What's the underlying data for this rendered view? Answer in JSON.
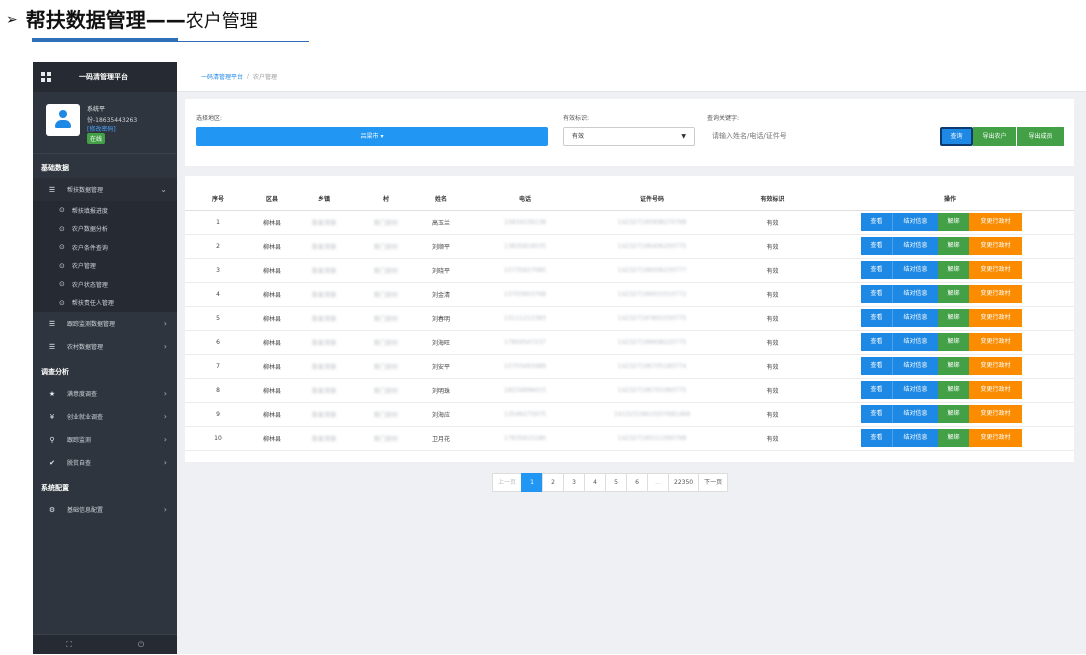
{
  "doc": {
    "arrow": "➢",
    "title_bold": "帮扶数据管理——",
    "title_thin": "农户管理"
  },
  "sidebar": {
    "brand": "一码清管理平台",
    "user": {
      "name": "系统平",
      "phone": "份-18635443263",
      "edit": "[修改密码]",
      "status": "在线"
    },
    "sections": {
      "basic": "基础数据",
      "survey": "调查分析",
      "system": "系统配置"
    },
    "items": {
      "help_data": "帮扶数据管理",
      "track": "跟踪监测数据管理",
      "village": "农村数据管理",
      "satisfaction": "满意度调查",
      "employment": "创业就业调查",
      "follow": "跟踪监测",
      "poverty": "脱贫自查",
      "base_config": "基础信息配置"
    },
    "subs": {
      "fill_progress": "帮扶填报进度",
      "farmer_analysis": "农户数据分析",
      "farmer_query": "农户条件查询",
      "farmer_mgmt": "农户管理",
      "farmer_status": "农户状态管理",
      "responsible": "帮扶责任人管理"
    },
    "bottom": {
      "left": "⛶",
      "right": "⏻"
    }
  },
  "breadcrumb": {
    "root": "一码清管理平台",
    "sep": "/",
    "current": "农户管理"
  },
  "filter": {
    "region_label": "选择地区:",
    "region_value": "吕梁市 ▾",
    "valid_label": "有效标识:",
    "valid_value": "有效",
    "keyword_label": "查询关键字:",
    "keyword_placeholder": "请输入姓名/电话/证件号",
    "query_btn": "查询",
    "export_farmer_btn": "导出农户",
    "export_member_btn": "导出成员"
  },
  "table": {
    "headers": {
      "idx": "序号",
      "county": "区县",
      "town": "乡镇",
      "village": "村",
      "name": "姓名",
      "phone": "电话",
      "id_no": "证件号码",
      "valid": "有效标识",
      "ops": "操作"
    },
    "op_labels": {
      "view": "查看",
      "pair": "结对信息",
      "unbind": "解绑",
      "change": "变更行政村"
    },
    "rows": [
      {
        "idx": "1",
        "county": "柳林县",
        "town": "陈家湾镇",
        "village": "新门前村",
        "name": "高玉兰",
        "phone": "15834236138",
        "id_no": "142327195908270768",
        "valid": "有效"
      },
      {
        "idx": "2",
        "county": "柳林县",
        "town": "陈家湾镇",
        "village": "新门前村",
        "name": "刘顺平",
        "phone": "13835816035",
        "id_no": "142327196406200775",
        "valid": "有效"
      },
      {
        "idx": "3",
        "county": "柳林县",
        "town": "陈家湾镇",
        "village": "新门前村",
        "name": "刘晓平",
        "phone": "15735627085",
        "id_no": "142327196006230777",
        "valid": "有效"
      },
      {
        "idx": "4",
        "county": "柳林县",
        "town": "陈家湾镇",
        "village": "新门前村",
        "name": "刘金清",
        "phone": "13703603768",
        "id_no": "142327196910310772",
        "valid": "有效"
      },
      {
        "idx": "5",
        "county": "柳林县",
        "town": "陈家湾镇",
        "village": "新门前村",
        "name": "刘春明",
        "phone": "13111212383",
        "id_no": "142327197801030775",
        "valid": "有效"
      },
      {
        "idx": "6",
        "county": "柳林县",
        "town": "陈家湾镇",
        "village": "新门前村",
        "name": "刘海旺",
        "phone": "17804547237",
        "id_no": "142327196608220775",
        "valid": "有效"
      },
      {
        "idx": "7",
        "county": "柳林县",
        "town": "陈家湾镇",
        "village": "新门前村",
        "name": "刘安平",
        "phone": "15703493489",
        "id_no": "142327196705180774",
        "valid": "有效"
      },
      {
        "idx": "8",
        "county": "柳林县",
        "town": "陈家湾镇",
        "village": "新门前村",
        "name": "刘明珠",
        "phone": "18234698415",
        "id_no": "142327196701060775",
        "valid": "有效"
      },
      {
        "idx": "9",
        "county": "柳林县",
        "town": "陈家湾镇",
        "village": "新门前村",
        "name": "刘海应",
        "phone": "13546275975",
        "id_no": "14132319610207681469",
        "valid": "有效"
      },
      {
        "idx": "10",
        "county": "柳林县",
        "town": "陈家湾镇",
        "village": "新门前村",
        "name": "卫月花",
        "phone": "17635615180",
        "id_no": "142327195511090768",
        "valid": "有效"
      }
    ]
  },
  "pagination": {
    "prev": "上一页",
    "pages": [
      "1",
      "2",
      "3",
      "4",
      "5",
      "6",
      "...",
      "22350"
    ],
    "next": "下一页"
  }
}
